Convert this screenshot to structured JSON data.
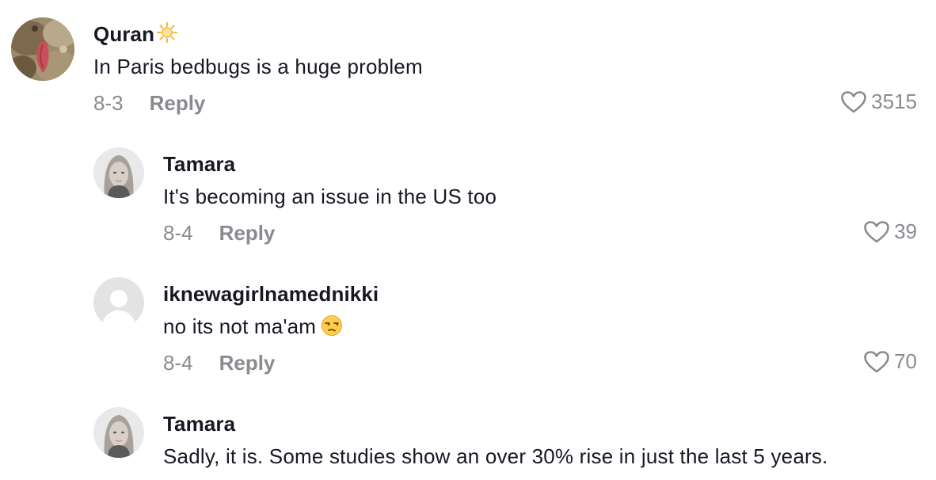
{
  "comments": [
    {
      "username": "Quran",
      "username_emoji": "sun-icon",
      "text": "In Paris bedbugs is a huge problem",
      "date": "8-3",
      "reply_label": "Reply",
      "likes": "3515"
    },
    {
      "username": "Tamara",
      "text": "It's becoming an issue in the US too",
      "date": "8-4",
      "reply_label": "Reply",
      "likes": "39"
    },
    {
      "username": "iknewagirlnamednikki",
      "text": "no its not ma'am",
      "text_emoji": "unamused-face-emoji",
      "date": "8-4",
      "reply_label": "Reply",
      "likes": "70"
    },
    {
      "username": "Tamara",
      "text": "Sadly, it is. Some studies show an over 30% rise in just the last 5 years."
    }
  ],
  "colors": {
    "text_primary": "#161823",
    "text_secondary": "#8a8b91",
    "background": "#ffffff"
  }
}
